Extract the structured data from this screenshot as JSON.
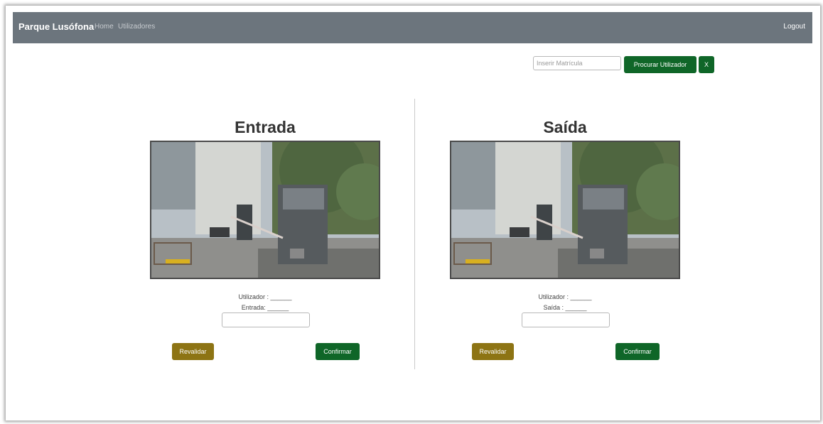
{
  "navbar": {
    "brand": "Parque Lusófona",
    "links": [
      "Home",
      "Utilizadores"
    ],
    "logout": "Logout"
  },
  "search": {
    "placeholder": "Inserir Matrícula",
    "search_button": "Procurar Utilizador",
    "clear_button": "X"
  },
  "entrada": {
    "title": "Entrada",
    "user_label": "Utilizador : ______",
    "time_label": "Entrada: ______",
    "revalidate_button": "Revalidar",
    "confirm_button": "Confirmar"
  },
  "saida": {
    "title": "Saída",
    "user_label": "Utilizador : ______",
    "time_label": "Saída : ______",
    "revalidate_button": "Revalidar",
    "confirm_button": "Confirmar"
  },
  "colors": {
    "navbar": "#6c757d",
    "green": "#0f6628",
    "gold": "#8d7414"
  }
}
